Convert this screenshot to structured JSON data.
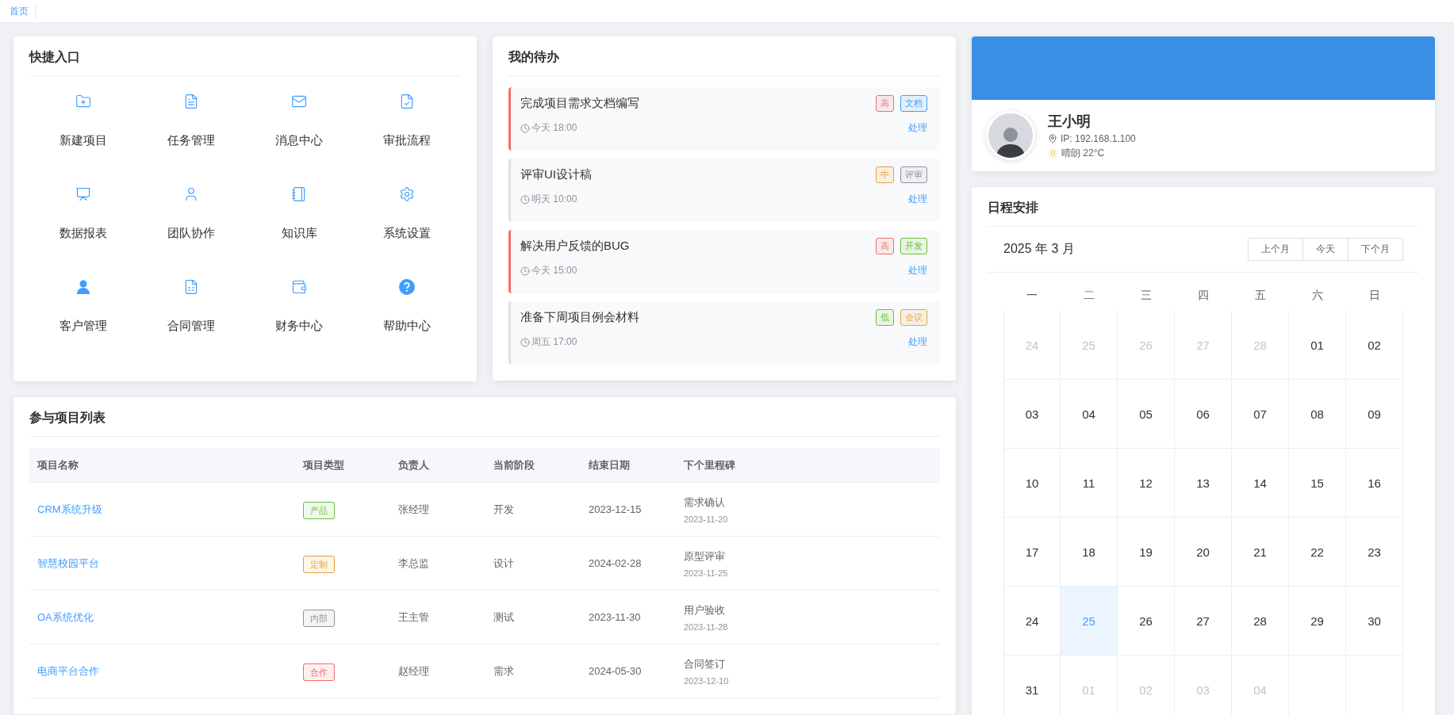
{
  "top_bar": {
    "tabs": [
      {
        "label": "首页",
        "selected": true
      }
    ]
  },
  "quick_entry": {
    "title": "快捷入口",
    "items": [
      {
        "label": "新建项目"
      },
      {
        "label": "任务管理"
      },
      {
        "label": "消息中心"
      },
      {
        "label": "审批流程"
      },
      {
        "label": "数据报表"
      },
      {
        "label": "团队协作"
      },
      {
        "label": "知识库"
      },
      {
        "label": "系统设置"
      },
      {
        "label": "客户管理"
      },
      {
        "label": "合同管理"
      },
      {
        "label": "财务中心"
      },
      {
        "label": "帮助中心"
      }
    ]
  },
  "todos": {
    "title": "我的待办",
    "items": [
      {
        "title": "完成项目需求文档编写",
        "time": "今天 18:00",
        "highlighted": true,
        "tags": [
          {
            "label": "高",
            "color": "#f56c6c"
          },
          {
            "label": "文档",
            "color": "#409eff"
          }
        ],
        "action": "处理"
      },
      {
        "title": "评审UI设计稿",
        "time": "明天 10:00",
        "highlighted": false,
        "tags": [
          {
            "label": "中",
            "color": "#e6a23c"
          },
          {
            "label": "评审",
            "color": "#909399"
          }
        ],
        "action": "处理"
      },
      {
        "title": "解决用户反馈的BUG",
        "time": "今天 15:00",
        "highlighted": true,
        "tags": [
          {
            "label": "高",
            "color": "#f56c6c"
          },
          {
            "label": "开发",
            "color": "#67c23a"
          }
        ],
        "action": "处理"
      },
      {
        "title": "准备下周项目例会材料",
        "time": "周五 17:00",
        "highlighted": false,
        "tags": [
          {
            "label": "低",
            "color": "#67c23a"
          },
          {
            "label": "会议",
            "color": "#e6a23c"
          }
        ],
        "action": "处理"
      }
    ]
  },
  "projects": {
    "title": "参与项目列表",
    "columns": [
      "项目名称",
      "项目类型",
      "负责人",
      "当前阶段",
      "结束日期",
      "下个里程碑"
    ],
    "rows": [
      {
        "name": "CRM系统升级",
        "type": {
          "label": "产品",
          "color": "#67c23a"
        },
        "owner": "张经理",
        "stage": "开发",
        "end_date": "2023-12-15",
        "milestone": "需求确认",
        "milestone_date": "2023-11-20"
      },
      {
        "name": "智慧校园平台",
        "type": {
          "label": "定制",
          "color": "#e6a23c"
        },
        "owner": "李总监",
        "stage": "设计",
        "end_date": "2024-02-28",
        "milestone": "原型评审",
        "milestone_date": "2023-11-25"
      },
      {
        "name": "OA系统优化",
        "type": {
          "label": "内部",
          "color": "#909399"
        },
        "owner": "王主管",
        "stage": "测试",
        "end_date": "2023-11-30",
        "milestone": "用户验收",
        "milestone_date": "2023-11-28"
      },
      {
        "name": "电商平台合作",
        "type": {
          "label": "合作",
          "color": "#f56c6c"
        },
        "owner": "赵经理",
        "stage": "需求",
        "end_date": "2024-05-30",
        "milestone": "合同签订",
        "milestone_date": "2023-12-10"
      }
    ]
  },
  "profile": {
    "name": "王小明",
    "ip": "IP: 192.168.1.100",
    "weather": "晴朗 22°C"
  },
  "schedule": {
    "title": "日程安排",
    "month": "2025 年 3 月",
    "buttons": [
      "上个月",
      "今天",
      "下个月"
    ],
    "weekdays": [
      "一",
      "二",
      "三",
      "四",
      "五",
      "六",
      "日"
    ],
    "days": [
      {
        "label": "24",
        "muted": true,
        "today": false
      },
      {
        "label": "25",
        "muted": true,
        "today": false
      },
      {
        "label": "26",
        "muted": true,
        "today": false
      },
      {
        "label": "27",
        "muted": true,
        "today": false
      },
      {
        "label": "28",
        "muted": true,
        "today": false
      },
      {
        "label": "01",
        "muted": false,
        "today": false
      },
      {
        "label": "02",
        "muted": false,
        "today": false
      },
      {
        "label": "03",
        "muted": false,
        "today": false
      },
      {
        "label": "04",
        "muted": false,
        "today": false
      },
      {
        "label": "05",
        "muted": false,
        "today": false
      },
      {
        "label": "06",
        "muted": false,
        "today": false
      },
      {
        "label": "07",
        "muted": false,
        "today": false
      },
      {
        "label": "08",
        "muted": false,
        "today": false
      },
      {
        "label": "09",
        "muted": false,
        "today": false
      },
      {
        "label": "10",
        "muted": false,
        "today": false
      },
      {
        "label": "11",
        "muted": false,
        "today": false
      },
      {
        "label": "12",
        "muted": false,
        "today": false
      },
      {
        "label": "13",
        "muted": false,
        "today": false
      },
      {
        "label": "14",
        "muted": false,
        "today": false
      },
      {
        "label": "15",
        "muted": false,
        "today": false
      },
      {
        "label": "16",
        "muted": false,
        "today": false
      },
      {
        "label": "17",
        "muted": false,
        "today": false
      },
      {
        "label": "18",
        "muted": false,
        "today": false
      },
      {
        "label": "19",
        "muted": false,
        "today": false
      },
      {
        "label": "20",
        "muted": false,
        "today": false
      },
      {
        "label": "21",
        "muted": false,
        "today": false
      },
      {
        "label": "22",
        "muted": false,
        "today": false
      },
      {
        "label": "23",
        "muted": false,
        "today": false
      },
      {
        "label": "24",
        "muted": false,
        "today": false
      },
      {
        "label": "25",
        "muted": false,
        "today": true
      },
      {
        "label": "26",
        "muted": false,
        "today": false
      },
      {
        "label": "27",
        "muted": false,
        "today": false
      },
      {
        "label": "28",
        "muted": false,
        "today": false
      },
      {
        "label": "29",
        "muted": false,
        "today": false
      },
      {
        "label": "30",
        "muted": false,
        "today": false
      },
      {
        "label": "31",
        "muted": false,
        "today": false
      },
      {
        "label": "01",
        "muted": true,
        "today": false
      },
      {
        "label": "02",
        "muted": true,
        "today": false
      },
      {
        "label": "03",
        "muted": true,
        "today": false
      },
      {
        "label": "04",
        "muted": true,
        "today": false
      }
    ]
  }
}
